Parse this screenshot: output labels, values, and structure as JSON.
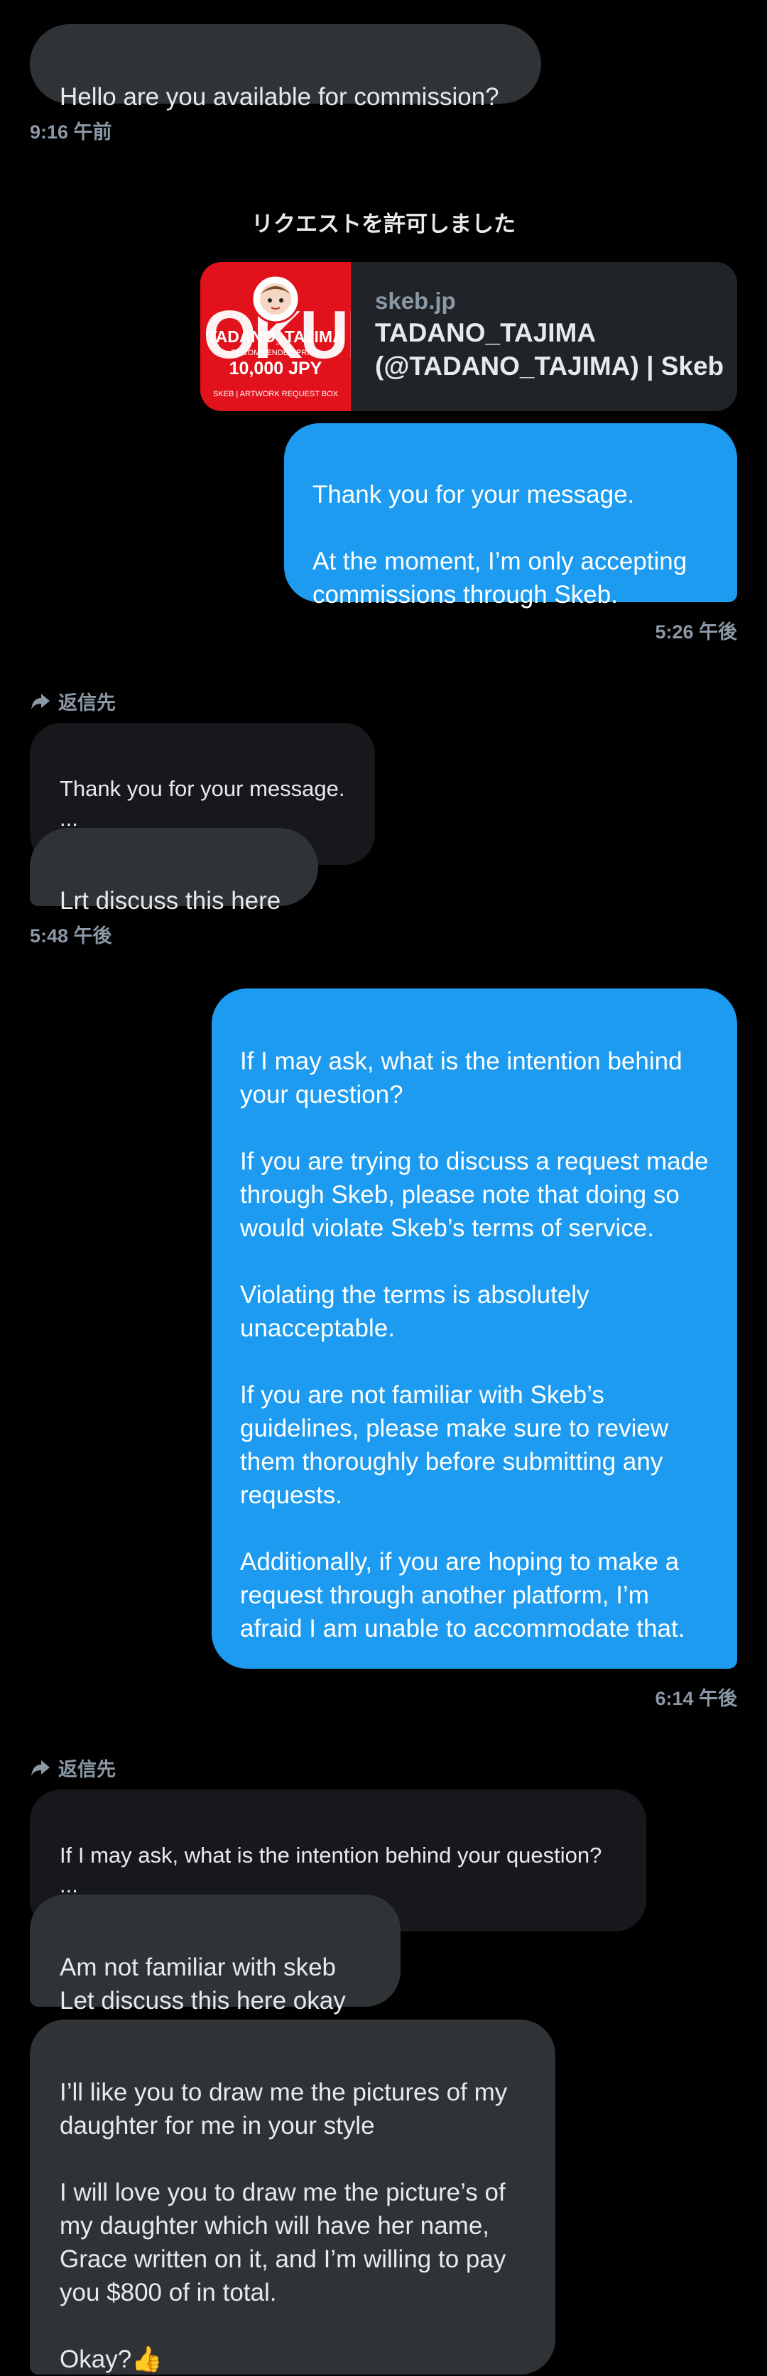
{
  "messages": {
    "m1": {
      "text": "Hello are you available for commission?",
      "time": "9:16 午前"
    },
    "system": "リクエストを許可しました",
    "card": {
      "domain": "skeb.jp",
      "title": "TADANO_TAJIMA\n(@TADANO_TAJIMA) | Skeb",
      "thumb": {
        "brand": "OKUR",
        "name": "TADANO_TAJIMA",
        "sub": "RECOMMENDED PRICE",
        "price": "10,000 JPY",
        "footer": "SKEB | ARTWORK REQUEST BOX"
      }
    },
    "m2": {
      "text": "Thank you for your message.\n\nAt the moment, I’m only accepting commissions through Skeb.",
      "time": "5:26 午後"
    },
    "reply1": {
      "label": "返信先",
      "quote": "Thank you for your message.\n...",
      "text": "Lrt discuss this here",
      "time": "5:48 午後"
    },
    "m3": {
      "text": "If I may ask, what is the intention behind your question?\n\nIf you are trying to discuss a request made through Skeb, please note that doing so would violate Skeb’s terms of service.\n\nViolating the terms is absolutely unacceptable.\n\nIf you are not familiar with Skeb’s guidelines, please make sure to review them thoroughly before submitting any requests.\n\nAdditionally, if you are hoping to make a request through another platform, I’m afraid I am unable to accommodate that.",
      "time": "6:14 午後"
    },
    "reply2": {
      "label": "返信先",
      "quote": "If I may ask, what is the intention behind your question?\n...",
      "text": "Am not familiar with skeb\n   Let discuss this here okay"
    },
    "m4": {
      "text": "I’ll like you to draw me the pictures of my daughter for me in your style\n\nI will love you to draw me the picture’s of my daughter which will have her name, Grace written on it, and I’m willing to pay you $800 of in total.\n\nOkay?👍"
    }
  },
  "colors": {
    "background": "#000000",
    "incoming": "#2f3336",
    "outgoing": "#1d9bf0",
    "quote": "#16181c",
    "muted": "#8b98a5",
    "thumb_red": "#e1121b"
  }
}
